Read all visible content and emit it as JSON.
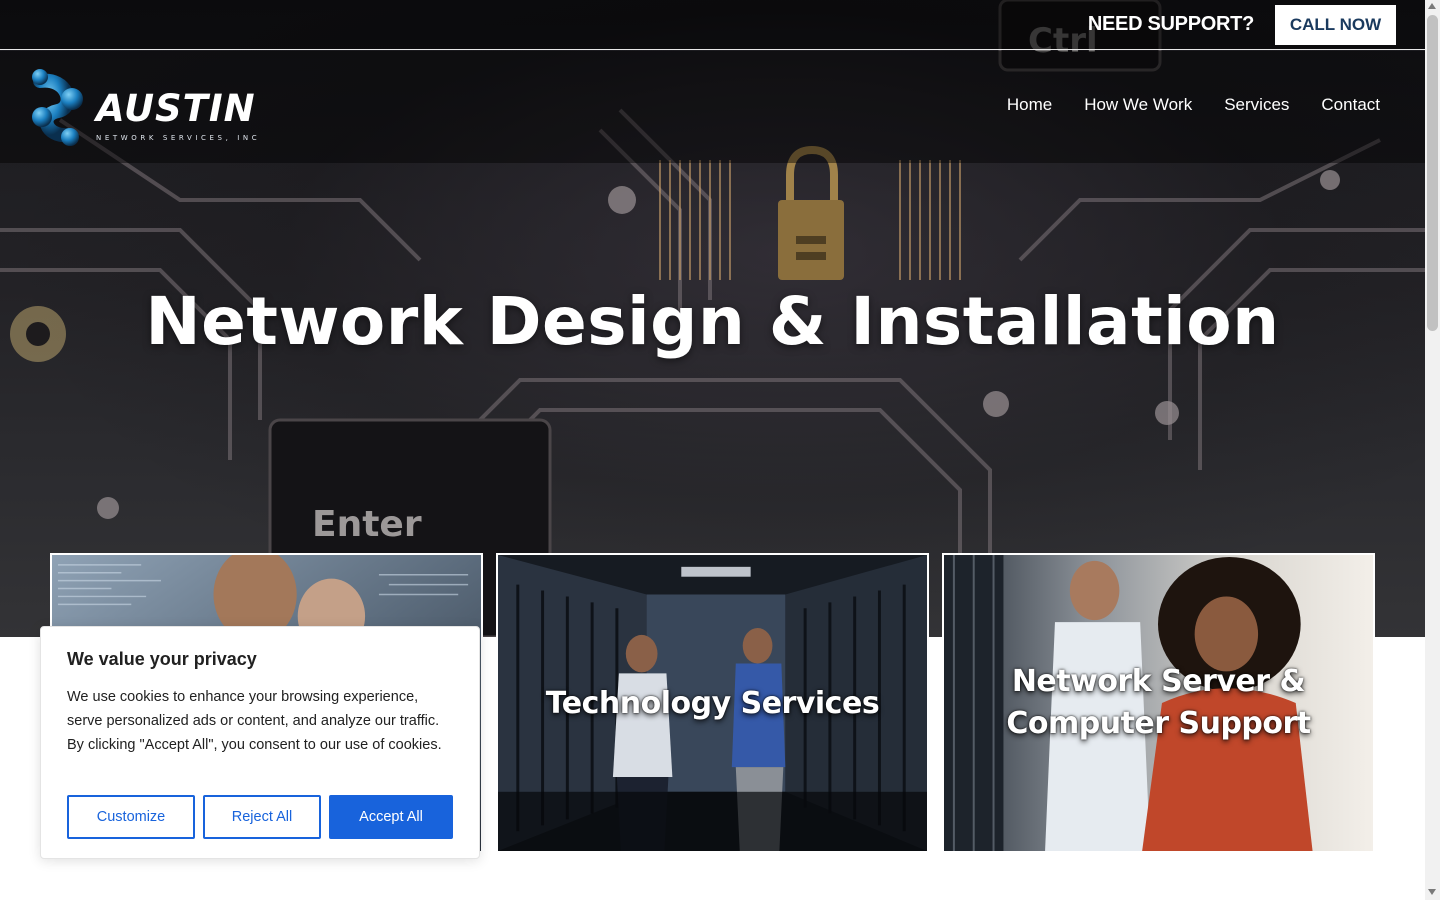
{
  "topbar": {
    "support_text": "NEED SUPPORT?",
    "call_label": "CALL NOW"
  },
  "brand": {
    "name": "AUSTIN",
    "subtitle": "NETWORK SERVICES, INC",
    "logo_icon": "network-molecule-icon"
  },
  "nav": {
    "items": [
      {
        "label": "Home"
      },
      {
        "label": "How We Work"
      },
      {
        "label": "Services"
      },
      {
        "label": "Contact"
      }
    ]
  },
  "hero": {
    "title": "Network Design & Installation",
    "keyboard_labels": [
      "Ctrl",
      "Enter"
    ]
  },
  "cards": [
    {
      "label": ""
    },
    {
      "label": "Technology Services"
    },
    {
      "label_line1": "Network Server &",
      "label_line2": "Computer Support"
    }
  ],
  "cookie": {
    "title": "We value your privacy",
    "text": "We use cookies to enhance your browsing experience, serve personalized ads or content, and analyze our traffic. By clicking \"Accept All\", you consent to our use of cookies.",
    "customize_label": "Customize",
    "reject_label": "Reject All",
    "accept_label": "Accept All"
  },
  "colors": {
    "primary_blue": "#1863dc",
    "call_text": "#1a3a5e",
    "logo_accent": "#2a9bd6"
  }
}
